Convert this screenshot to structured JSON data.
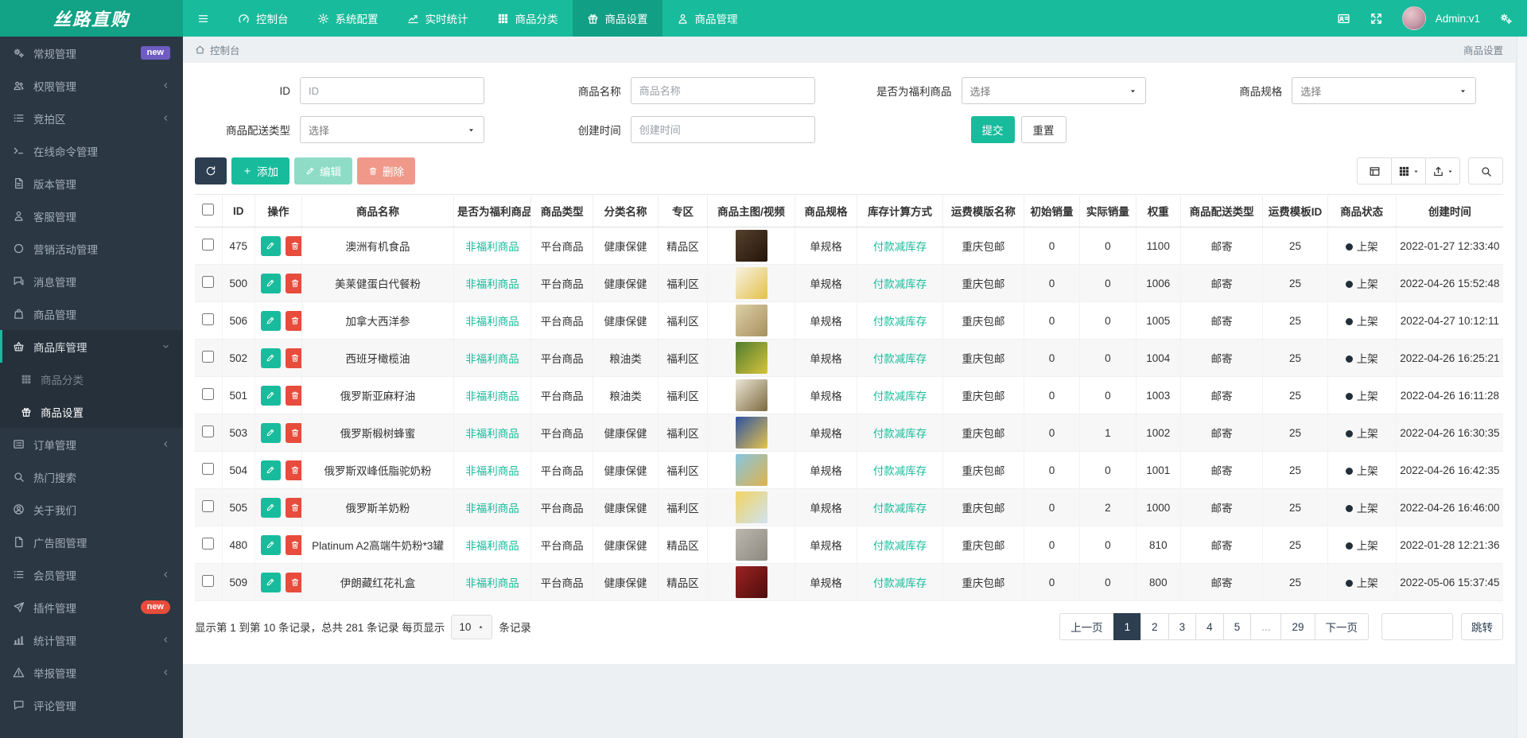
{
  "colors": {
    "accent": "#18bc9c",
    "navy": "#2c3e50",
    "danger": "#e74c3c",
    "sidebar_bg": "#2b3743",
    "badge_purple": "#6e5cc3",
    "badge_red": "#e74c3c"
  },
  "navbar": {
    "brand": "丝路直购",
    "items": [
      {
        "key": "dashboard",
        "icon": "gauge",
        "label": "控制台"
      },
      {
        "key": "system-config",
        "icon": "gear",
        "label": "系统配置"
      },
      {
        "key": "realtime-stats",
        "icon": "stats",
        "label": "实时统计"
      },
      {
        "key": "product-category",
        "icon": "grid",
        "label": "商品分类"
      },
      {
        "key": "product-settings",
        "icon": "gift",
        "label": "商品设置",
        "active": true
      },
      {
        "key": "product-manage",
        "icon": "person",
        "label": "商品管理"
      }
    ],
    "user": "Admin:v1"
  },
  "sidebar": {
    "items": [
      {
        "key": "general",
        "icon": "cogs",
        "label": "常规管理",
        "badge": "new",
        "badge_color": "#6e5cc3",
        "badge_pill": false
      },
      {
        "key": "permission",
        "icon": "users",
        "label": "权限管理",
        "arrow": "left"
      },
      {
        "key": "auction",
        "icon": "list",
        "label": "竞拍区",
        "arrow": "left"
      },
      {
        "key": "online-cmd",
        "icon": "terminal",
        "label": "在线命令管理"
      },
      {
        "key": "version",
        "icon": "filetext",
        "label": "版本管理"
      },
      {
        "key": "service",
        "icon": "person",
        "label": "客服管理"
      },
      {
        "key": "marketing",
        "icon": "circle",
        "label": "营销活动管理"
      },
      {
        "key": "message",
        "icon": "comments",
        "label": "消息管理"
      },
      {
        "key": "product",
        "icon": "bag",
        "label": "商品管理"
      },
      {
        "key": "product-lib",
        "icon": "basket",
        "label": "商品库管理",
        "arrow": "down",
        "open": true,
        "children": [
          {
            "key": "product-category",
            "icon": "grid",
            "label": "商品分类"
          },
          {
            "key": "product-settings",
            "icon": "gift",
            "label": "商品设置",
            "active": true
          }
        ]
      },
      {
        "key": "order",
        "icon": "listalt",
        "label": "订单管理",
        "arrow": "left"
      },
      {
        "key": "hot-search",
        "icon": "search",
        "label": "热门搜索"
      },
      {
        "key": "about",
        "icon": "usercircle",
        "label": "关于我们"
      },
      {
        "key": "ad-image",
        "icon": "file",
        "label": "广告图管理"
      },
      {
        "key": "member",
        "icon": "list",
        "label": "会员管理",
        "arrow": "left"
      },
      {
        "key": "plugin",
        "icon": "plane",
        "label": "插件管理",
        "badge": "new",
        "badge_color": "#e74c3c",
        "badge_pill": true
      },
      {
        "key": "stats",
        "icon": "chart",
        "label": "统计管理",
        "arrow": "left"
      },
      {
        "key": "report",
        "icon": "warn",
        "label": "举报管理",
        "arrow": "left"
      },
      {
        "key": "comment",
        "icon": "comment",
        "label": "评论管理"
      }
    ]
  },
  "breadcrumb": {
    "left": "控制台",
    "right": "商品设置"
  },
  "filters": {
    "fields": {
      "id": {
        "label": "ID",
        "placeholder": "ID"
      },
      "name": {
        "label": "商品名称",
        "placeholder": "商品名称"
      },
      "welfare": {
        "label": "是否为福利商品",
        "value": "选择"
      },
      "spec": {
        "label": "商品规格",
        "value": "选择"
      },
      "delivery": {
        "label": "商品配送类型",
        "value": "选择"
      },
      "created": {
        "label": "创建时间",
        "placeholder": "创建时间"
      }
    },
    "submit": "提交",
    "reset": "重置"
  },
  "toolbar": {
    "add": "添加",
    "edit": "编辑",
    "delete": "删除"
  },
  "table": {
    "col_keys": [
      "checkbox",
      "id",
      "ops",
      "name",
      "welfare",
      "type",
      "category",
      "zone",
      "image",
      "spec",
      "stock-method",
      "freight-name",
      "init-sales",
      "actual-sales",
      "weight",
      "delivery-type",
      "template-id",
      "status",
      "created"
    ],
    "columns": [
      "",
      "ID",
      "操作",
      "商品名称",
      "是否为福利商品",
      "商品类型",
      "分类名称",
      "专区",
      "商品主图/视频",
      "商品规格",
      "库存计算方式",
      "运费模版名称",
      "初始销量",
      "实际销量",
      "权重",
      "商品配送类型",
      "运费模板ID",
      "商品状态",
      "创建时间"
    ],
    "rows": [
      {
        "id": "475",
        "name": "澳洲有机食品",
        "welfare": "非福利商品",
        "type": "平台商品",
        "category": "健康保健",
        "zone": "精品区",
        "thumb": [
          "#55402c",
          "#241509"
        ],
        "spec": "单规格",
        "stock": "付款减库存",
        "freight": "重庆包邮",
        "init_sales": "0",
        "actual_sales": "0",
        "weight": "1100",
        "delivery": "邮寄",
        "template_id": "25",
        "status": "上架",
        "created": "2022-01-27 12:33:40"
      },
      {
        "id": "500",
        "name": "美莱健蛋白代餐粉",
        "welfare": "非福利商品",
        "type": "平台商品",
        "category": "健康保健",
        "zone": "福利区",
        "thumb": [
          "#f7f3e4",
          "#e4c04a"
        ],
        "spec": "单规格",
        "stock": "付款减库存",
        "freight": "重庆包邮",
        "init_sales": "0",
        "actual_sales": "0",
        "weight": "1006",
        "delivery": "邮寄",
        "template_id": "25",
        "status": "上架",
        "created": "2022-04-26 15:52:48"
      },
      {
        "id": "506",
        "name": "加拿大西洋参",
        "welfare": "非福利商品",
        "type": "平台商品",
        "category": "健康保健",
        "zone": "福利区",
        "thumb": [
          "#ddd0a8",
          "#a8905e"
        ],
        "spec": "单规格",
        "stock": "付款减库存",
        "freight": "重庆包邮",
        "init_sales": "0",
        "actual_sales": "0",
        "weight": "1005",
        "delivery": "邮寄",
        "template_id": "25",
        "status": "上架",
        "created": "2022-04-27 10:12:11"
      },
      {
        "id": "502",
        "name": "西班牙橄榄油",
        "welfare": "非福利商品",
        "type": "平台商品",
        "category": "粮油类",
        "zone": "福利区",
        "thumb": [
          "#4f7d2f",
          "#d8c33b"
        ],
        "spec": "单规格",
        "stock": "付款减库存",
        "freight": "重庆包邮",
        "init_sales": "0",
        "actual_sales": "0",
        "weight": "1004",
        "delivery": "邮寄",
        "template_id": "25",
        "status": "上架",
        "created": "2022-04-26 16:25:21"
      },
      {
        "id": "501",
        "name": "俄罗斯亚麻籽油",
        "welfare": "非福利商品",
        "type": "平台商品",
        "category": "粮油类",
        "zone": "福利区",
        "thumb": [
          "#ece6d6",
          "#7c6a3e"
        ],
        "spec": "单规格",
        "stock": "付款减库存",
        "freight": "重庆包邮",
        "init_sales": "0",
        "actual_sales": "0",
        "weight": "1003",
        "delivery": "邮寄",
        "template_id": "25",
        "status": "上架",
        "created": "2022-04-26 16:11:28"
      },
      {
        "id": "503",
        "name": "俄罗斯椴树蜂蜜",
        "welfare": "非福利商品",
        "type": "平台商品",
        "category": "健康保健",
        "zone": "福利区",
        "thumb": [
          "#2d52a4",
          "#e6c34a"
        ],
        "spec": "单规格",
        "stock": "付款减库存",
        "freight": "重庆包邮",
        "init_sales": "0",
        "actual_sales": "1",
        "weight": "1002",
        "delivery": "邮寄",
        "template_id": "25",
        "status": "上架",
        "created": "2022-04-26 16:30:35"
      },
      {
        "id": "504",
        "name": "俄罗斯双峰低脂驼奶粉",
        "welfare": "非福利商品",
        "type": "平台商品",
        "category": "健康保健",
        "zone": "福利区",
        "thumb": [
          "#85c6e2",
          "#dfb24c"
        ],
        "spec": "单规格",
        "stock": "付款减库存",
        "freight": "重庆包邮",
        "init_sales": "0",
        "actual_sales": "0",
        "weight": "1001",
        "delivery": "邮寄",
        "template_id": "25",
        "status": "上架",
        "created": "2022-04-26 16:42:35"
      },
      {
        "id": "505",
        "name": "俄罗斯羊奶粉",
        "welfare": "非福利商品",
        "type": "平台商品",
        "category": "健康保健",
        "zone": "福利区",
        "thumb": [
          "#f2d463",
          "#cfe2ef"
        ],
        "spec": "单规格",
        "stock": "付款减库存",
        "freight": "重庆包邮",
        "init_sales": "0",
        "actual_sales": "2",
        "weight": "1000",
        "delivery": "邮寄",
        "template_id": "25",
        "status": "上架",
        "created": "2022-04-26 16:46:00"
      },
      {
        "id": "480",
        "name": "Platinum A2高端牛奶粉*3罐",
        "welfare": "非福利商品",
        "type": "平台商品",
        "category": "健康保健",
        "zone": "精品区",
        "thumb": [
          "#bcb8b0",
          "#8d897f"
        ],
        "spec": "单规格",
        "stock": "付款减库存",
        "freight": "重庆包邮",
        "init_sales": "0",
        "actual_sales": "0",
        "weight": "810",
        "delivery": "邮寄",
        "template_id": "25",
        "status": "上架",
        "created": "2022-01-28 12:21:36"
      },
      {
        "id": "509",
        "name": "伊朗藏红花礼盒",
        "welfare": "非福利商品",
        "type": "平台商品",
        "category": "健康保健",
        "zone": "精品区",
        "thumb": [
          "#9c2222",
          "#4f0d0d"
        ],
        "spec": "单规格",
        "stock": "付款减库存",
        "freight": "重庆包邮",
        "init_sales": "0",
        "actual_sales": "0",
        "weight": "800",
        "delivery": "邮寄",
        "template_id": "25",
        "status": "上架",
        "created": "2022-05-06 15:37:45"
      }
    ]
  },
  "pagination": {
    "info_prefix": "显示第 1 到第 10 条记录，总共 281 条记录 每页显示",
    "page_size": "10",
    "info_suffix": "条记录",
    "pages": [
      {
        "label": "上一页"
      },
      {
        "label": "1",
        "active": true
      },
      {
        "label": "2"
      },
      {
        "label": "3"
      },
      {
        "label": "4"
      },
      {
        "label": "5"
      },
      {
        "label": "...",
        "disabled": true
      },
      {
        "label": "29"
      },
      {
        "label": "下一页"
      }
    ],
    "jump_label": "跳转"
  }
}
